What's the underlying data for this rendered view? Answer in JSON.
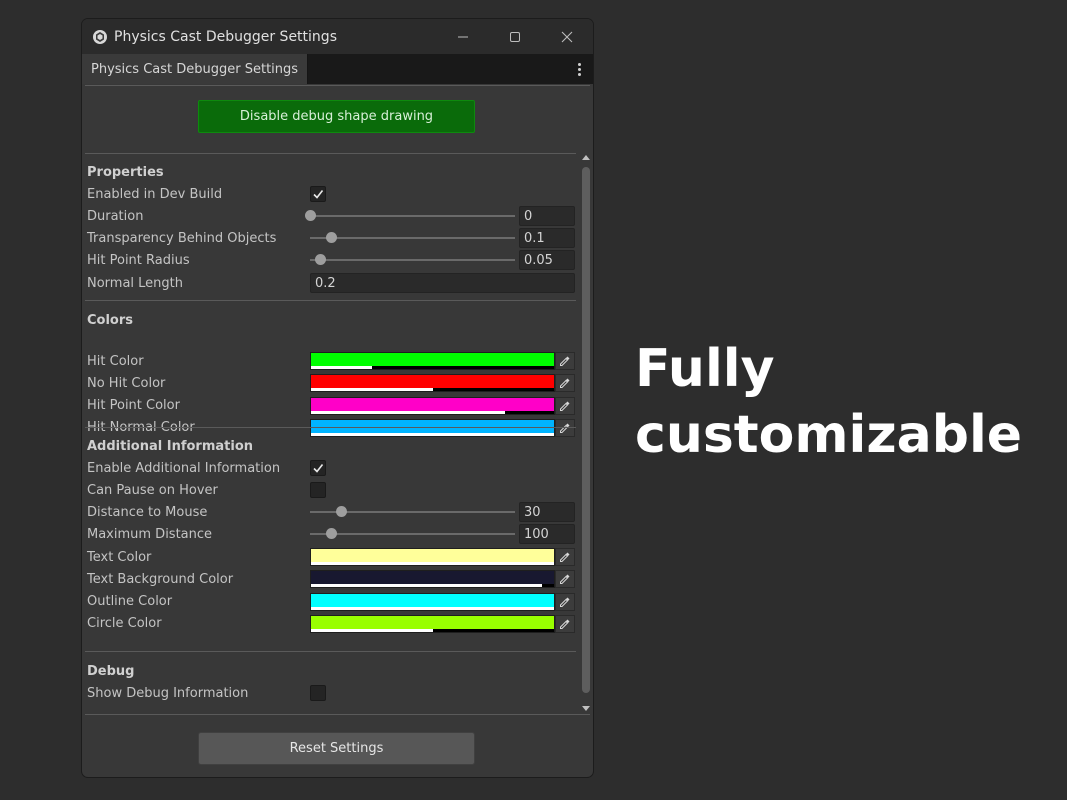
{
  "window": {
    "title": "Physics Cast Debugger Settings",
    "tab_label": "Physics Cast Debugger Settings"
  },
  "top_button": "Disable debug shape drawing",
  "properties": {
    "header": "Properties",
    "enabled_label": "Enabled in Dev Build",
    "enabled_checked": true,
    "duration_label": "Duration",
    "duration_value": "0",
    "duration_fraction": 0.0,
    "transparency_label": "Transparency Behind Objects",
    "transparency_value": "0.1",
    "transparency_fraction": 0.1,
    "hit_radius_label": "Hit Point Radius",
    "hit_radius_value": "0.05",
    "hit_radius_fraction": 0.05,
    "normal_length_label": "Normal Length",
    "normal_length_value": "0.2"
  },
  "colors": {
    "header": "Colors",
    "items": [
      {
        "label": "Hit Color",
        "color": "#00ff00",
        "alpha": 0.25
      },
      {
        "label": "No Hit Color",
        "color": "#ff0000",
        "alpha": 0.5
      },
      {
        "label": "Hit Point Color",
        "color": "#ff00c8",
        "alpha": 0.8
      },
      {
        "label": "Hit Normal Color",
        "color": "#00b4ff",
        "alpha": 1.0
      }
    ]
  },
  "additional": {
    "header": "Additional Information",
    "enable_label": "Enable Additional Information",
    "enable_checked": true,
    "pause_label": "Can Pause on Hover",
    "pause_checked": false,
    "distance_mouse_label": "Distance to Mouse",
    "distance_mouse_value": "30",
    "distance_mouse_fraction": 0.15,
    "max_distance_label": "Maximum Distance",
    "max_distance_value": "100",
    "max_distance_fraction": 0.1,
    "color_items": [
      {
        "label": "Text Color",
        "color": "#ffff9a",
        "alpha": 1.0
      },
      {
        "label": "Text Background Color",
        "color": "#181830",
        "alpha": 0.95
      },
      {
        "label": "Outline Color",
        "color": "#00ffff",
        "alpha": 1.0
      },
      {
        "label": "Circle Color",
        "color": "#99ff00",
        "alpha": 0.5
      }
    ]
  },
  "debug": {
    "header": "Debug",
    "show_label": "Show Debug Information",
    "show_checked": false
  },
  "reset_button": "Reset Settings",
  "promo_line1": "Fully",
  "promo_line2": "customizable"
}
